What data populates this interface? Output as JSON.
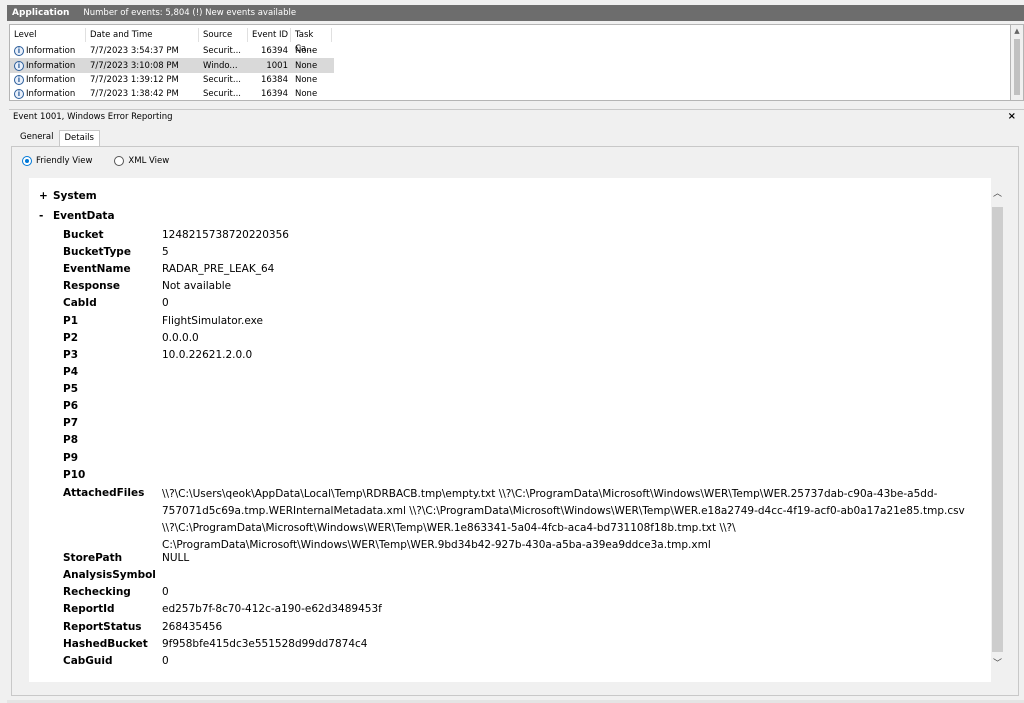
{
  "titlebar": {
    "app": "Application",
    "events_text": "Number of events: 5,804 (!) New events available"
  },
  "event_list": {
    "columns": [
      "Level",
      "Date and Time",
      "Source",
      "Event ID",
      "Task Ca..."
    ],
    "rows": [
      {
        "level": "Information",
        "date": "7/7/2023 3:54:37 PM",
        "source": "Securit...",
        "event_id": "16394",
        "task": "None"
      },
      {
        "level": "Information",
        "date": "7/7/2023 3:10:08 PM",
        "source": "Windo...",
        "event_id": "1001",
        "task": "None"
      },
      {
        "level": "Information",
        "date": "7/7/2023 1:39:12 PM",
        "source": "Securit...",
        "event_id": "16384",
        "task": "None"
      },
      {
        "level": "Information",
        "date": "7/7/2023 1:38:42 PM",
        "source": "Securit...",
        "event_id": "16394",
        "task": "None"
      }
    ],
    "selected_index": 1
  },
  "detail": {
    "title": "Event 1001, Windows Error Reporting",
    "close_glyph": "×",
    "tabs": [
      "General",
      "Details"
    ],
    "active_tab": "Details",
    "view_options": [
      "Friendly View",
      "XML View"
    ],
    "selected_view": "Friendly View"
  },
  "friendly_view": {
    "system": {
      "toggle": "+",
      "label": "System"
    },
    "eventdata": {
      "toggle": "-",
      "label": "EventData"
    },
    "fields": {
      "bucket": {
        "name": "Bucket",
        "value": "1248215738720220356"
      },
      "buckettype": {
        "name": "BucketType",
        "value": "5"
      },
      "eventname": {
        "name": "EventName",
        "value": "RADAR_PRE_LEAK_64"
      },
      "response": {
        "name": "Response",
        "value": "Not available"
      },
      "cabid": {
        "name": "CabId",
        "value": "0"
      },
      "p1": {
        "name": "P1",
        "value": "FlightSimulator.exe"
      },
      "p2": {
        "name": "P2",
        "value": "0.0.0.0"
      },
      "p3": {
        "name": "P3",
        "value": "10.0.22621.2.0.0"
      },
      "p4": {
        "name": "P4",
        "value": ""
      },
      "p5": {
        "name": "P5",
        "value": ""
      },
      "p6": {
        "name": "P6",
        "value": ""
      },
      "p7": {
        "name": "P7",
        "value": ""
      },
      "p8": {
        "name": "P8",
        "value": ""
      },
      "p9": {
        "name": "P9",
        "value": ""
      },
      "p10": {
        "name": "P10",
        "value": ""
      },
      "attachedfiles": {
        "name": "AttachedFiles",
        "lines": [
          "\\\\?\\C:\\Users\\qeok\\AppData\\Local\\Temp\\RDRBACB.tmp\\empty.txt \\\\?\\C:\\ProgramData\\Microsoft\\Windows\\WER\\Temp\\WER.25737dab-c90a-43be-a5dd-",
          "757071d5c69a.tmp.WERInternalMetadata.xml \\\\?\\C:\\ProgramData\\Microsoft\\Windows\\WER\\Temp\\WER.e18a2749-d4cc-4f19-acf0-ab0a17a21e85.tmp.csv",
          "\\\\?\\C:\\ProgramData\\Microsoft\\Windows\\WER\\Temp\\WER.1e863341-5a04-4fcb-aca4-bd731108f18b.tmp.txt \\\\?\\",
          "C:\\ProgramData\\Microsoft\\Windows\\WER\\Temp\\WER.9bd34b42-927b-430a-a5ba-a39ea9ddce3a.tmp.xml"
        ]
      },
      "storepath": {
        "name": "StorePath",
        "value": "NULL"
      },
      "analysissymbol": {
        "name": "AnalysisSymbol",
        "value": ""
      },
      "rechecking": {
        "name": "Rechecking",
        "value": "0"
      },
      "reportid": {
        "name": "ReportId",
        "value": "ed257b7f-8c70-412c-a190-e62d3489453f"
      },
      "reportstatus": {
        "name": "ReportStatus",
        "value": "268435456"
      },
      "hashedbucket": {
        "name": "HashedBucket",
        "value": "9f958bfe415dc3e551528d99dd7874c4"
      },
      "cabguid": {
        "name": "CabGuid",
        "value": "0"
      }
    }
  },
  "icons": {
    "info": "information-icon",
    "scroll_up": "chevron-up-icon",
    "scroll_down": "chevron-down-icon"
  },
  "colors": {
    "titlebar_bg": "#6d6d6d",
    "selected_row": "#d9d9d9",
    "radio_accent": "#0078d7"
  }
}
